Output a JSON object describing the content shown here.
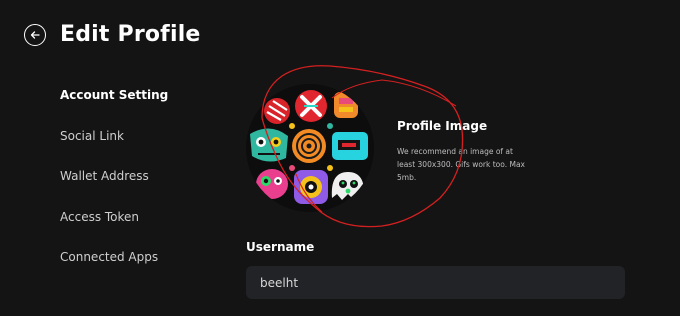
{
  "header": {
    "back_icon": "arrow-left-circle-icon",
    "title": "Edit Profile"
  },
  "sidebar": {
    "items": [
      {
        "label": "Account Setting",
        "active": true
      },
      {
        "label": "Social Link",
        "active": false
      },
      {
        "label": "Wallet Address",
        "active": false
      },
      {
        "label": "Access Token",
        "active": false
      },
      {
        "label": "Connected Apps",
        "active": false
      }
    ]
  },
  "profile_image": {
    "title": "Profile Image",
    "description": "We recommend an image of at least 300x300. Gifs work too. Max 5mb."
  },
  "username": {
    "label": "Username",
    "value": "beelht"
  },
  "colors": {
    "background": "#141414",
    "input_background": "#222327",
    "annotation": "#d42020"
  }
}
